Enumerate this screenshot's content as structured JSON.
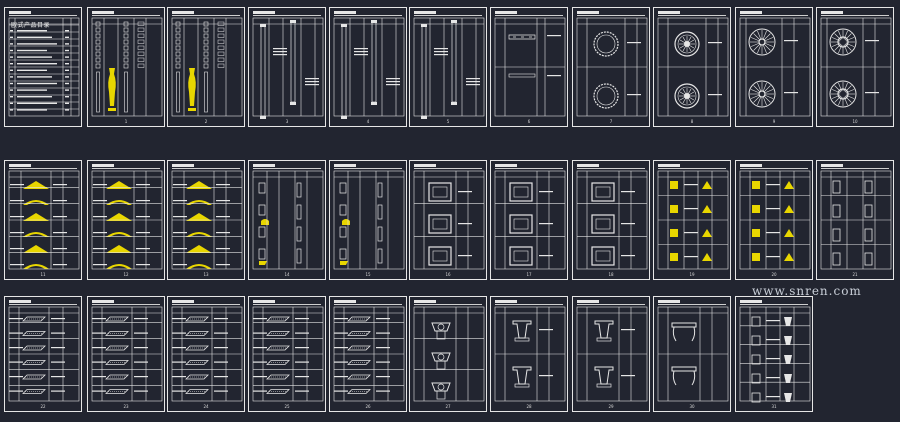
{
  "index_sheet": {
    "title": "欧式产品目录"
  },
  "page_numbers": [
    "1",
    "2",
    "3",
    "4",
    "5",
    "6",
    "7",
    "8",
    "9",
    "10",
    "11",
    "12",
    "13",
    "14",
    "15",
    "16",
    "17",
    "18",
    "19",
    "20",
    "21",
    "22",
    "23",
    "24",
    "25",
    "26",
    "27",
    "28",
    "29",
    "30",
    "31"
  ],
  "watermark": "www.snren.com",
  "colors": {
    "background": "#222530",
    "line": "#e6e6e6",
    "highlight": "#e8d600"
  }
}
